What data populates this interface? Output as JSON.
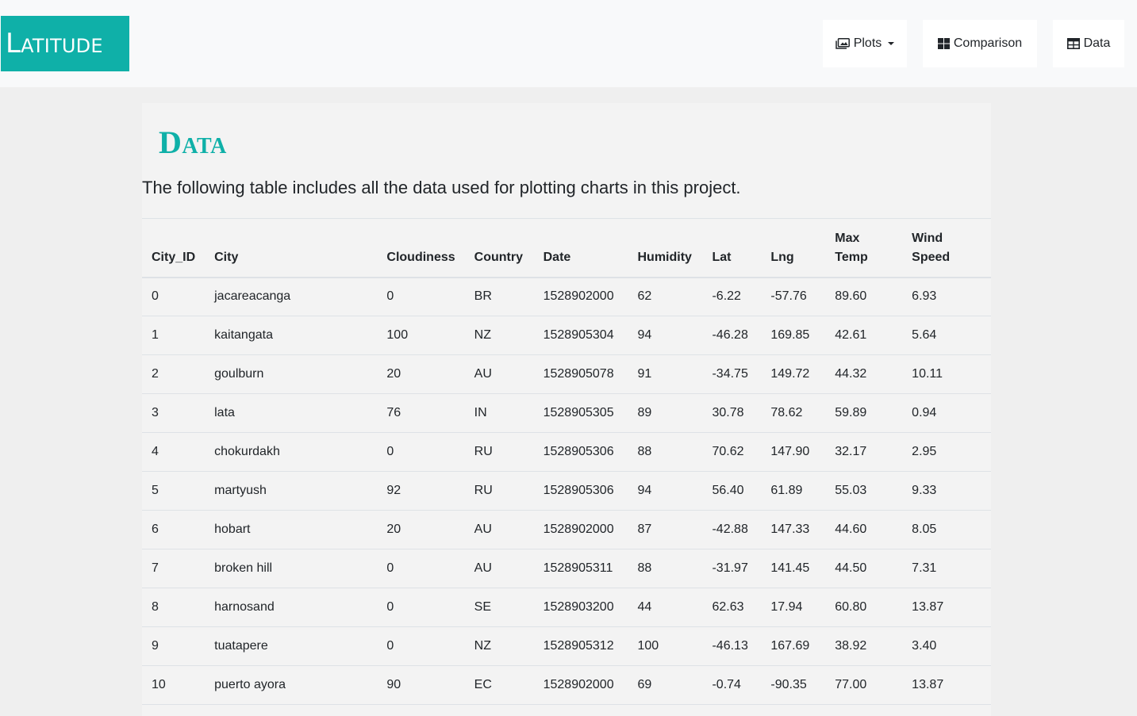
{
  "brand": "Latitude",
  "nav": {
    "plots_label": "Plots",
    "comparison_label": "Comparison",
    "data_label": "Data"
  },
  "page": {
    "title": "Data",
    "lead": "The following table includes all the data used for plotting charts in this project."
  },
  "table": {
    "headers": [
      "City_ID",
      "City",
      "Cloudiness",
      "Country",
      "Date",
      "Humidity",
      "Lat",
      "Lng",
      "Max Temp",
      "Wind Speed"
    ],
    "rows": [
      [
        "0",
        "jacareacanga",
        "0",
        "BR",
        "1528902000",
        "62",
        "-6.22",
        "-57.76",
        "89.60",
        "6.93"
      ],
      [
        "1",
        "kaitangata",
        "100",
        "NZ",
        "1528905304",
        "94",
        "-46.28",
        "169.85",
        "42.61",
        "5.64"
      ],
      [
        "2",
        "goulburn",
        "20",
        "AU",
        "1528905078",
        "91",
        "-34.75",
        "149.72",
        "44.32",
        "10.11"
      ],
      [
        "3",
        "lata",
        "76",
        "IN",
        "1528905305",
        "89",
        "30.78",
        "78.62",
        "59.89",
        "0.94"
      ],
      [
        "4",
        "chokurdakh",
        "0",
        "RU",
        "1528905306",
        "88",
        "70.62",
        "147.90",
        "32.17",
        "2.95"
      ],
      [
        "5",
        "martyush",
        "92",
        "RU",
        "1528905306",
        "94",
        "56.40",
        "61.89",
        "55.03",
        "9.33"
      ],
      [
        "6",
        "hobart",
        "20",
        "AU",
        "1528902000",
        "87",
        "-42.88",
        "147.33",
        "44.60",
        "8.05"
      ],
      [
        "7",
        "broken hill",
        "0",
        "AU",
        "1528905311",
        "88",
        "-31.97",
        "141.45",
        "44.50",
        "7.31"
      ],
      [
        "8",
        "harnosand",
        "0",
        "SE",
        "1528903200",
        "44",
        "62.63",
        "17.94",
        "60.80",
        "13.87"
      ],
      [
        "9",
        "tuatapere",
        "0",
        "NZ",
        "1528905312",
        "100",
        "-46.13",
        "167.69",
        "38.92",
        "3.40"
      ],
      [
        "10",
        "puerto ayora",
        "90",
        "EC",
        "1528902000",
        "69",
        "-0.74",
        "-90.35",
        "77.00",
        "13.87"
      ]
    ]
  }
}
